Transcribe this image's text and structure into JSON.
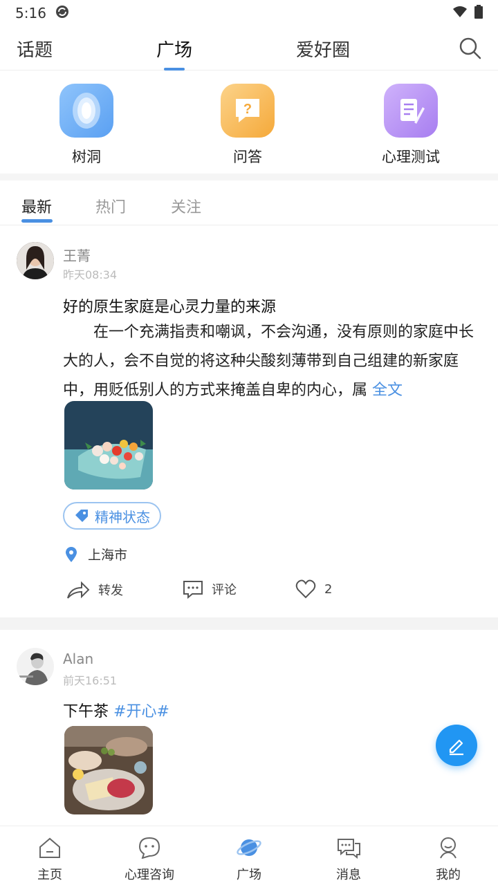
{
  "status_bar": {
    "time": "5:16"
  },
  "top_tabs": [
    {
      "label": "话题"
    },
    {
      "label": "广场"
    },
    {
      "label": "爱好圈"
    }
  ],
  "quick": [
    {
      "label": "树洞",
      "icon": "tree-hole-icon",
      "color": "#6aaef5"
    },
    {
      "label": "问答",
      "icon": "qa-icon",
      "color": "#f7b94f"
    },
    {
      "label": "心理测试",
      "icon": "test-icon",
      "color": "#b68cf0"
    }
  ],
  "sub_tabs": [
    {
      "label": "最新"
    },
    {
      "label": "热门"
    },
    {
      "label": "关注"
    }
  ],
  "posts": [
    {
      "author": "王菁",
      "time": "昨天08:34",
      "title": "好的原生家庭是心灵力量的来源",
      "body": "在一个充满指责和嘲讽，不会沟通，没有原则的家庭中长大的人，会不自觉的将这种尖酸刻薄带到自己组建的新家庭中，用贬低别人的方式来掩盖自卑的内心，属",
      "fulltext": "全文",
      "tag": "精神状态",
      "location": "上海市",
      "actions": {
        "share": "转发",
        "comment": "评论",
        "likes": "2"
      }
    },
    {
      "author": "Alan",
      "time": "前天16:51",
      "title": "下午茶",
      "hashtag": "#开心#"
    }
  ],
  "bottom_nav": [
    {
      "label": "主页"
    },
    {
      "label": "心理咨询"
    },
    {
      "label": "广场"
    },
    {
      "label": "消息"
    },
    {
      "label": "我的"
    }
  ],
  "colors": {
    "accent": "#4a90e2",
    "fab": "#2196f3"
  }
}
